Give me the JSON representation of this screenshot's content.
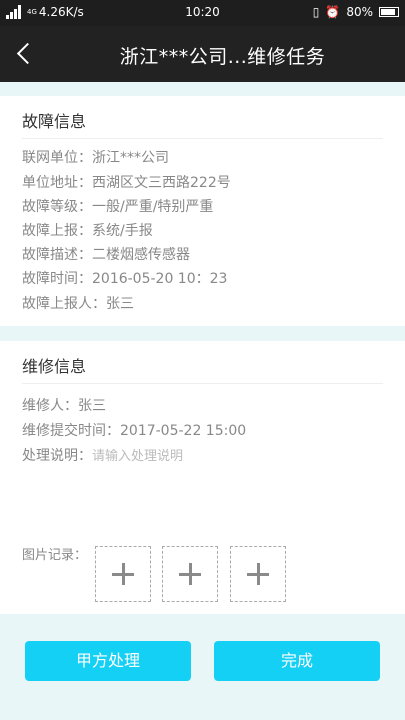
{
  "status_bar": {
    "network_type": "4G",
    "speed": "4.26K/s",
    "time": "10:20",
    "battery": "80%"
  },
  "nav": {
    "title": "浙江***公司...维修任务"
  },
  "fault_info": {
    "title": "故障信息",
    "rows": [
      {
        "label": "联网单位：",
        "value": "浙江***公司"
      },
      {
        "label": "单位地址：",
        "value": "西湖区文三西路222号"
      },
      {
        "label": "故障等级：",
        "value": "一般/严重/特别严重"
      },
      {
        "label": "故障上报：",
        "value": "系统/手报"
      },
      {
        "label": "故障描述：",
        "value": "二楼烟感传感器"
      },
      {
        "label": "故障时间：",
        "value": "2016-05-20 10：23"
      },
      {
        "label": "故障上报人：",
        "value": "张三"
      }
    ]
  },
  "repair_info": {
    "title": "维修信息",
    "repairer_label": "维修人：",
    "repairer_value": "张三",
    "submit_time_label": "维修提交时间：",
    "submit_time_value": "2017-05-22 15:00",
    "note_label": "处理说明：",
    "note_placeholder": "请输入处理说明",
    "photo_label": "图片记录："
  },
  "actions": {
    "party_a_label": "甲方处理",
    "complete_label": "完成"
  }
}
